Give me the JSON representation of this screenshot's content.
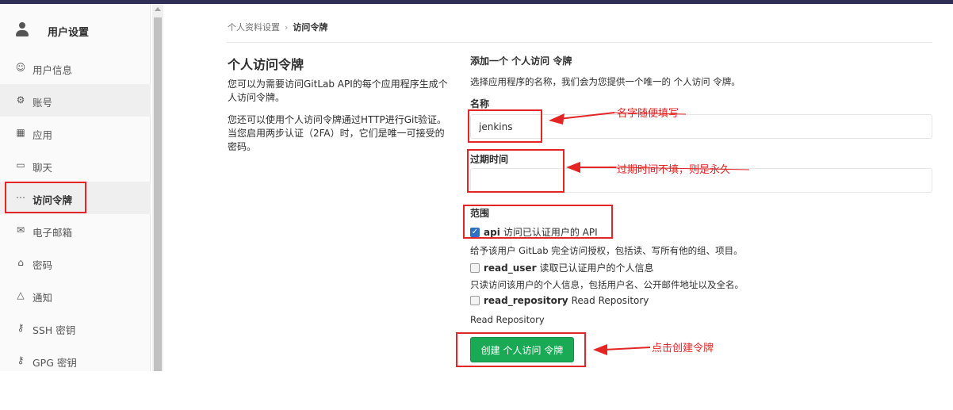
{
  "sidebar": {
    "title": "用户设置",
    "items": [
      {
        "icon": "profile-icon",
        "glyph": "☺",
        "label": "用户信息"
      },
      {
        "icon": "account-icon",
        "glyph": "⚙",
        "label": "账号"
      },
      {
        "icon": "applications-icon",
        "glyph": "▦",
        "label": "应用"
      },
      {
        "icon": "chat-icon",
        "glyph": "▭",
        "label": "聊天"
      },
      {
        "icon": "access-token-icon",
        "glyph": "⋯",
        "label": "访问令牌"
      },
      {
        "icon": "email-icon",
        "glyph": "✉",
        "label": "电子邮箱"
      },
      {
        "icon": "lock-icon",
        "glyph": "⌂",
        "label": "密码"
      },
      {
        "icon": "bell-icon",
        "glyph": "△",
        "label": "通知"
      },
      {
        "icon": "key-icon",
        "glyph": "⚷",
        "label": "SSH 密钥"
      },
      {
        "icon": "key-icon",
        "glyph": "⚷",
        "label": "GPG 密钥"
      }
    ]
  },
  "breadcrumb": {
    "parent": "个人资料设置",
    "separator": "›",
    "current": "访问令牌"
  },
  "info": {
    "title": "个人访问令牌",
    "p1": "您可以为需要访问GitLab API的每个应用程序生成个人访问令牌。",
    "p2": "您还可以使用个人访问令牌通过HTTP进行Git验证。 当您启用两步认证（2FA）时，它们是唯一可接受的密码。"
  },
  "form": {
    "title": "添加一个 个人访问 令牌",
    "description": "选择应用程序的名称，我们会为您提供一个唯一的 个人访问 令牌。",
    "name_label": "名称",
    "name_value": "jenkins",
    "expires_label": "过期时间",
    "expires_value": "",
    "scopes_label": "范围",
    "scopes": [
      {
        "name": "api",
        "text": "访问已认证用户的 API",
        "checked": true,
        "help": "给予该用户 GitLab 完全访问授权，包括读、写所有他的组、项目。"
      },
      {
        "name": "read_user",
        "text": "读取已认证用户的个人信息",
        "checked": false,
        "help": "只读访问该用户的个人信息，包括用户名、公开邮件地址以及全名。"
      },
      {
        "name": "read_repository",
        "text": "Read Repository",
        "checked": false,
        "help": "Read Repository"
      }
    ],
    "submit_label": "创建 个人访问 令牌"
  },
  "annotations": {
    "name_hint": "名字随便填写",
    "expires_hint": "过期时间不填，则是永久",
    "create_hint": "点击创建令牌"
  },
  "colors": {
    "annotation_red": "#e42525",
    "button_green": "#1aaa55",
    "topbar": "#2f2e54"
  }
}
